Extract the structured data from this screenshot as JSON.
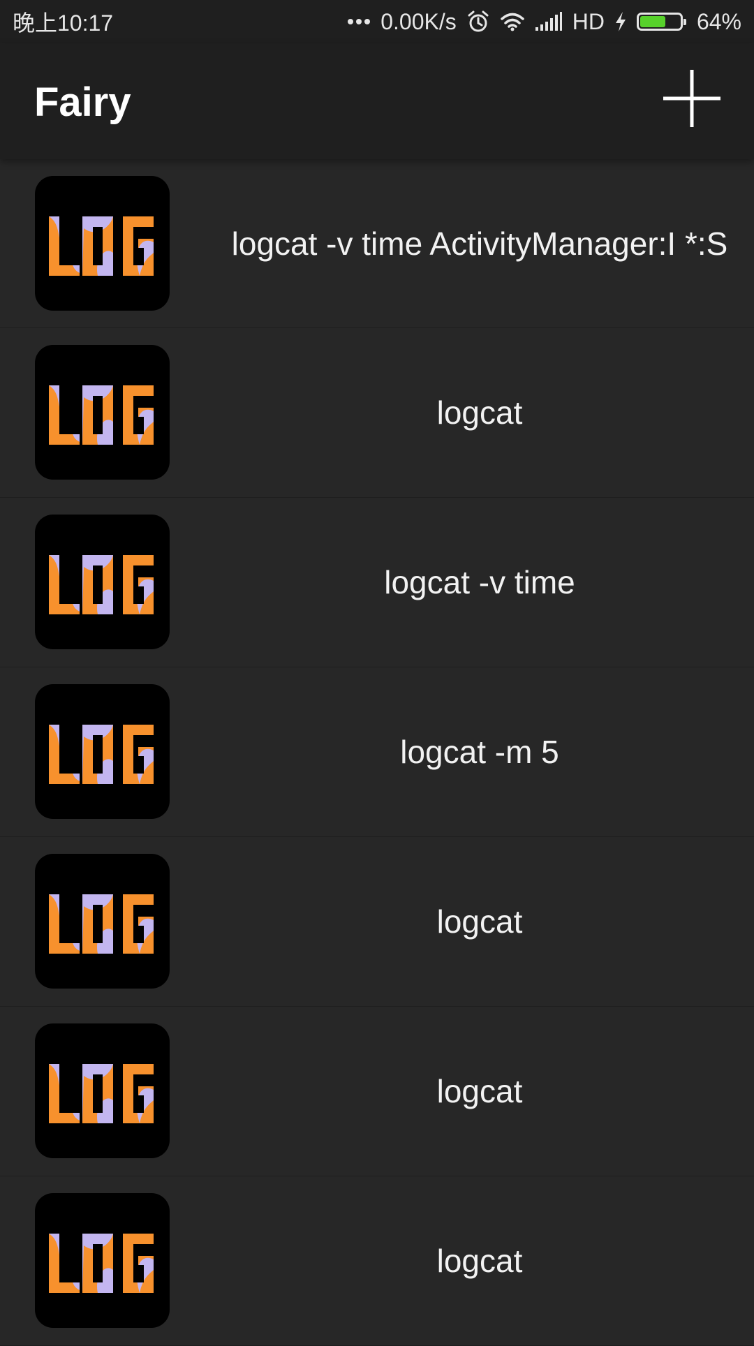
{
  "status_bar": {
    "time": "晚上10:17",
    "net_speed": "0.00K/s",
    "network_type": "HD",
    "battery_level": 0.64,
    "battery_text": "64%",
    "icons": [
      "dots-icon",
      "alarm-icon",
      "wifi-icon",
      "signal-icon",
      "charging-icon",
      "battery-icon"
    ]
  },
  "app_bar": {
    "title": "Fairy",
    "add_icon": "plus-icon"
  },
  "list": {
    "icon_name": "log-icon",
    "items": [
      {
        "label": "logcat -v time ActivityManager:I *:S"
      },
      {
        "label": "logcat"
      },
      {
        "label": "logcat -v time"
      },
      {
        "label": "logcat -m 5"
      },
      {
        "label": "logcat"
      },
      {
        "label": "logcat"
      },
      {
        "label": "logcat"
      }
    ]
  },
  "colors": {
    "background": "#272727",
    "app_bar": "#1f1f1f",
    "log_orange": "#f7912d",
    "log_lavender": "#c3b6f0",
    "battery_green": "#57d12b"
  }
}
